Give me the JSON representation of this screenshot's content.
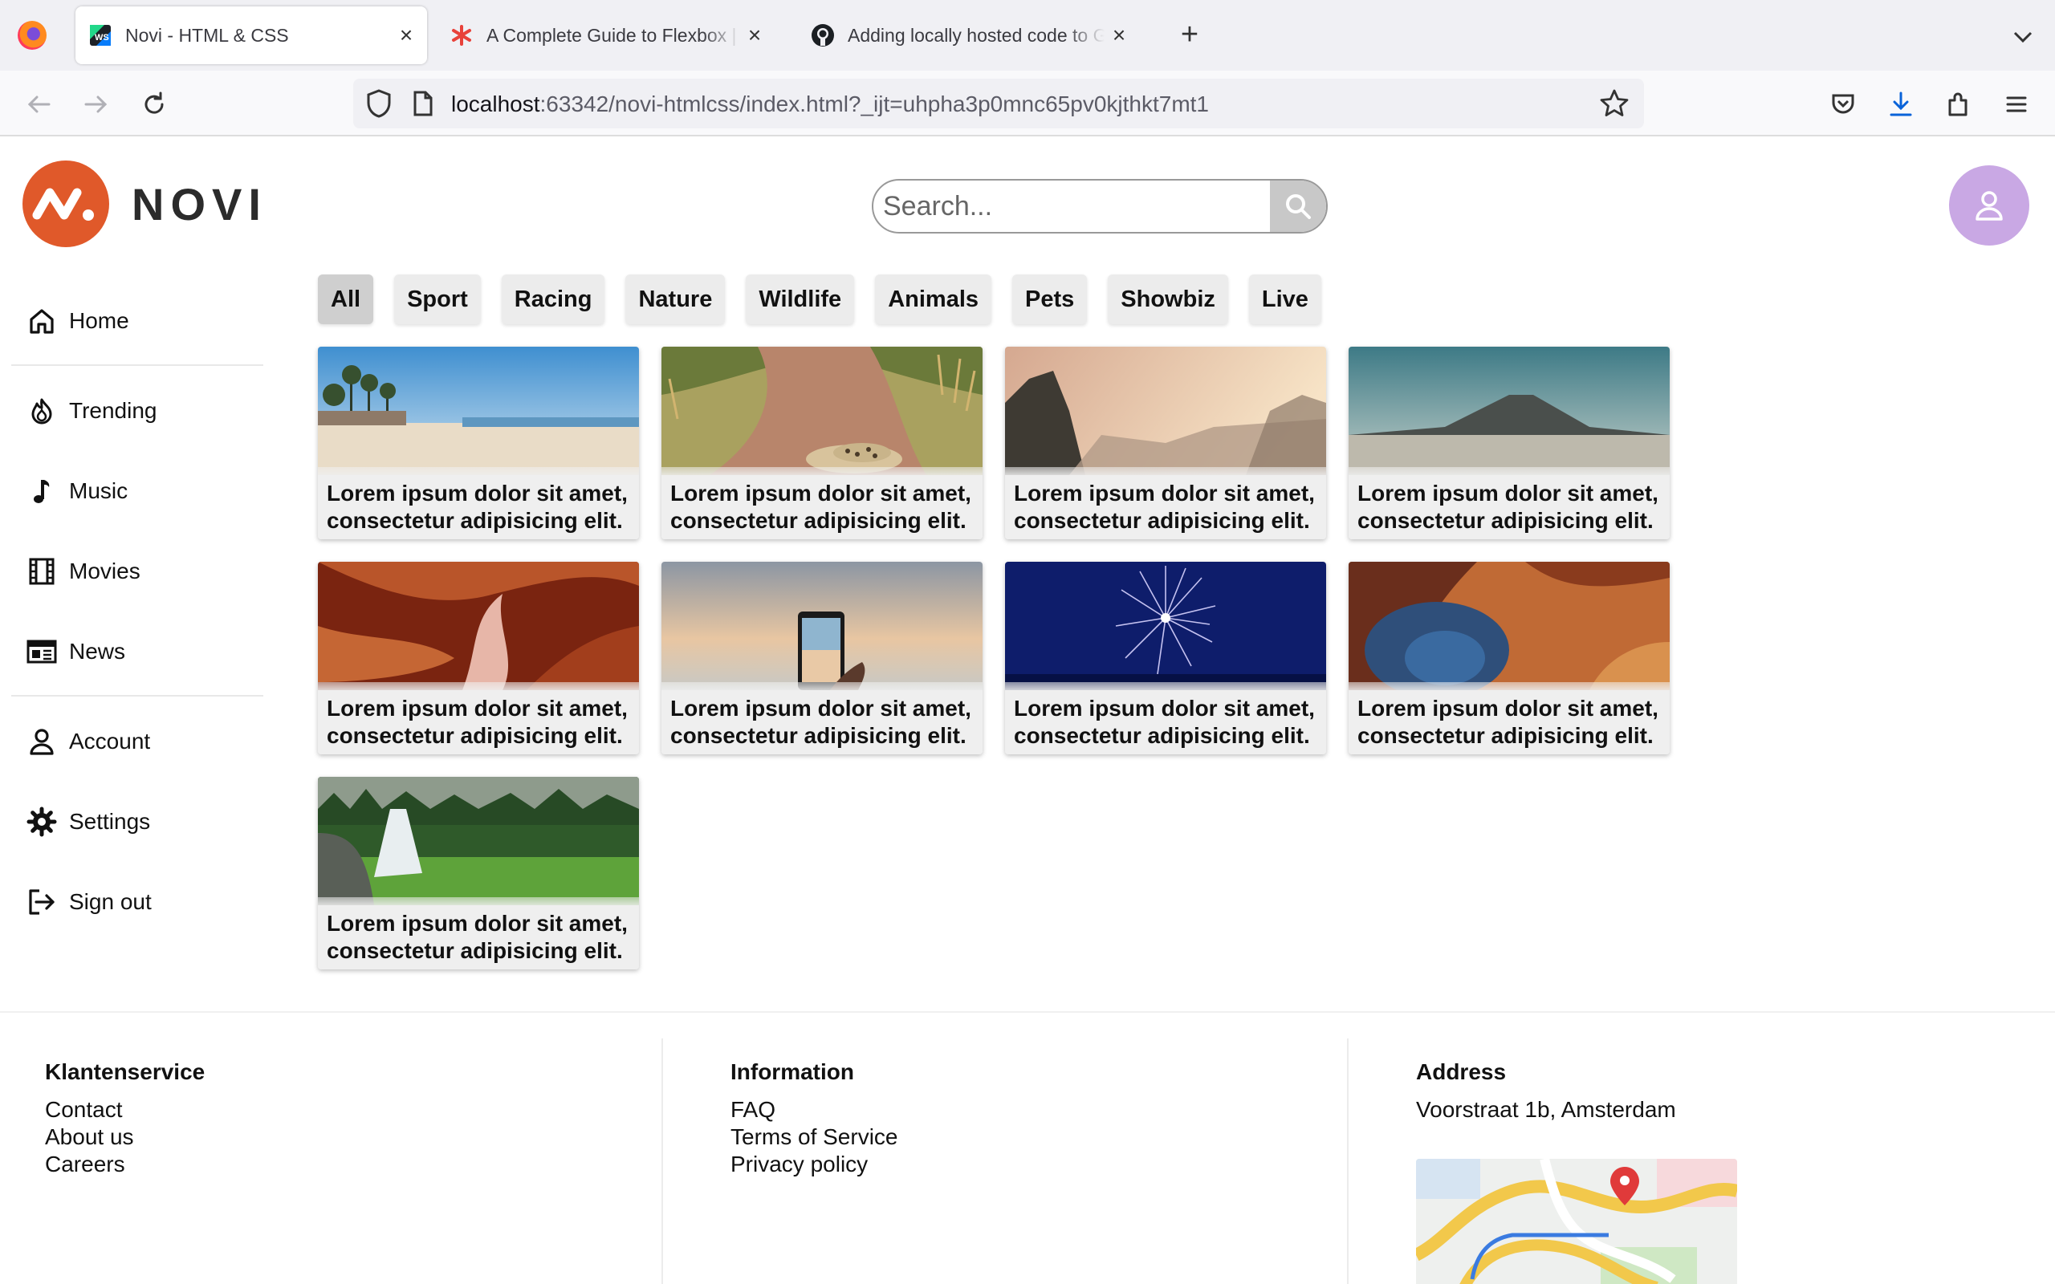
{
  "browser": {
    "tabs": [
      {
        "title": "Novi - HTML & CSS",
        "close": "×"
      },
      {
        "title": "A Complete Guide to Flexbox | CSS-Tricks",
        "close": "×"
      },
      {
        "title": "Adding locally hosted code to GitHub",
        "close": "×"
      }
    ],
    "new_tab": "+",
    "url_host": "localhost",
    "url_rest": ":63342/novi-htmlcss/index.html?_ijt=uhpha3p0mnc65pv0kjthkt7mt1"
  },
  "header": {
    "logo_text": "NOVI",
    "search_placeholder": "Search...",
    "brand_color": "#e0592a",
    "avatar_color": "#c9a8e4"
  },
  "sidebar": {
    "items": [
      {
        "label": "Home",
        "icon": "home-icon"
      },
      {
        "label": "Trending",
        "icon": "flame-icon"
      },
      {
        "label": "Music",
        "icon": "music-note-icon"
      },
      {
        "label": "Movies",
        "icon": "film-icon"
      },
      {
        "label": "News",
        "icon": "newspaper-icon"
      },
      {
        "label": "Account",
        "icon": "user-icon"
      },
      {
        "label": "Settings",
        "icon": "gear-icon"
      },
      {
        "label": "Sign out",
        "icon": "sign-out-icon"
      }
    ]
  },
  "categories": [
    "All",
    "Sport",
    "Racing",
    "Nature",
    "Wildlife",
    "Animals",
    "Pets",
    "Showbiz",
    "Live"
  ],
  "cards": [
    {
      "caption": "Lorem ipsum dolor sit amet, consectetur adipisicing elit.",
      "image": "beach"
    },
    {
      "caption": "Lorem ipsum dolor sit amet, consectetur adipisicing elit.",
      "image": "leopard-on-path"
    },
    {
      "caption": "Lorem ipsum dolor sit amet, consectetur adipisicing elit.",
      "image": "cliffs-sunset"
    },
    {
      "caption": "Lorem ipsum dolor sit amet, consectetur adipisicing elit.",
      "image": "volcano-mist"
    },
    {
      "caption": "Lorem ipsum dolor sit amet, consectetur adipisicing elit.",
      "image": "red-canyon"
    },
    {
      "caption": "Lorem ipsum dolor sit amet, consectetur adipisicing elit.",
      "image": "phone-photo-sea"
    },
    {
      "caption": "Lorem ipsum dolor sit amet, consectetur adipisicing elit.",
      "image": "fireworks"
    },
    {
      "caption": "Lorem ipsum dolor sit amet, consectetur adipisicing elit.",
      "image": "aerial-crater"
    },
    {
      "caption": "Lorem ipsum dolor sit amet, consectetur adipisicing elit.",
      "image": "waterfall-forest"
    }
  ],
  "footer": {
    "columns": [
      {
        "title": "Klantenservice",
        "links": [
          "Contact",
          "About us",
          "Careers"
        ]
      },
      {
        "title": "Information",
        "links": [
          "FAQ",
          "Terms of Service",
          "Privacy policy"
        ]
      },
      {
        "title": "Address",
        "links": [
          "Voorstraat 1b, Amsterdam"
        ]
      }
    ]
  }
}
